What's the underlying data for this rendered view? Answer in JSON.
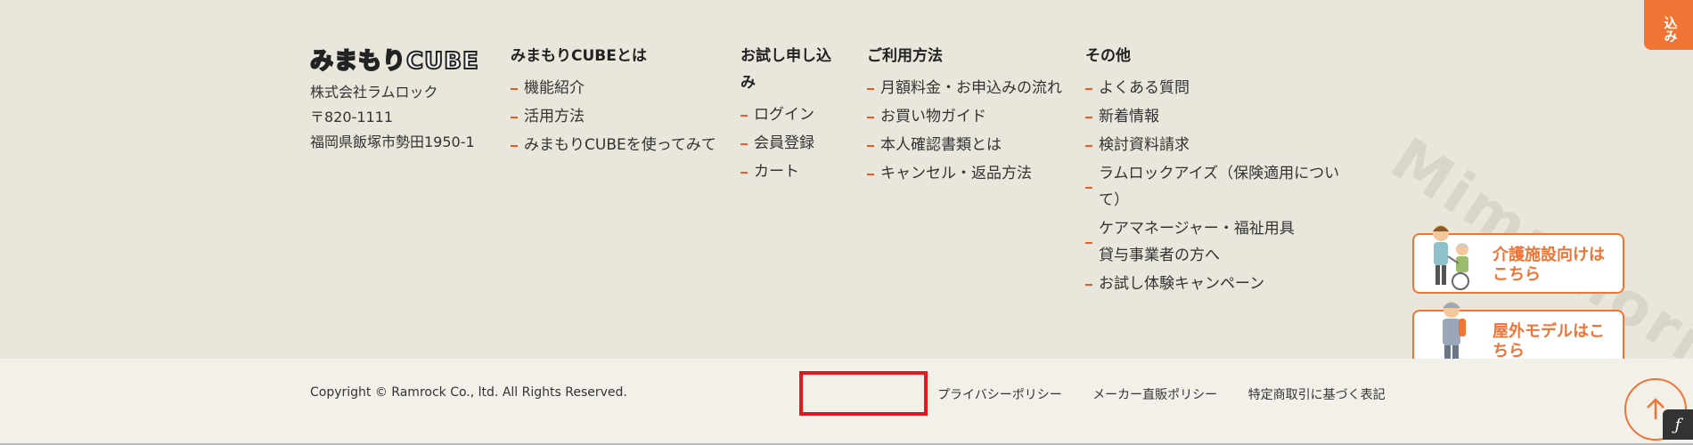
{
  "apply_tab": {
    "label": "込み"
  },
  "watermark": {
    "text": "Mimamori Cu"
  },
  "company": {
    "logo_text": "みまもりCUBE",
    "name": "株式会社ラムロック",
    "postal": "〒820-1111",
    "address": "福岡県飯塚市勢田1950-1"
  },
  "columns": [
    {
      "title": "みまもりCUBEとは",
      "items": [
        "機能紹介",
        "活用方法",
        "みまもりCUBEを使ってみて"
      ]
    },
    {
      "title": "お試し申し込み",
      "items": [
        "ログイン",
        "会員登録",
        "カート"
      ]
    },
    {
      "title": "ご利用方法",
      "items": [
        "月額料金・お申込みの流れ",
        "お買い物ガイド",
        "本人確認書類とは",
        "キャンセル・返品方法"
      ]
    },
    {
      "title": "その他",
      "items": [
        "よくある質問",
        "新着情報",
        "検討資料請求",
        "ラムロックアイズ（保険適用について）",
        "ケアマネージャー・福祉用具貸与事業者の方へ",
        "お試し体験キャンペーン"
      ]
    }
  ],
  "promos": {
    "care": {
      "label": "介護施設向けはこちら"
    },
    "outdoor": {
      "label": "屋外モデルはこちら"
    }
  },
  "footer": {
    "copyright": "Copyright © Ramrock Co., ltd. All Rights Reserved.",
    "links": [
      "プライバシーポリシー",
      "メーカー直販ポリシー",
      "特定商取引に基づく表記"
    ]
  },
  "colors": {
    "accent": "#f07434",
    "background": "#e9e6dc",
    "bottom_bg": "#f2f0e9",
    "highlight": "#e0191e"
  },
  "icons": {
    "to_top": "arrow-up-icon",
    "badge": "script-f-icon"
  }
}
